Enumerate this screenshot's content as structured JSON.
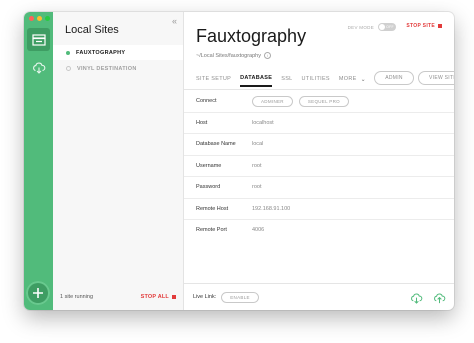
{
  "sites": {
    "title": "Local Sites",
    "collapse_icon": "«",
    "items": [
      {
        "label": "FAUXTOGRAPHY",
        "running": true
      },
      {
        "label": "VINYL DESTINATION",
        "running": false
      }
    ],
    "footer_status": "1 site running",
    "stop_all_label": "STOP ALL"
  },
  "header": {
    "title": "Fauxtography",
    "path": "~/Local Sites/fauxtography",
    "devmode_label": "DEV MODE",
    "devmode_toggle": "OFF",
    "stop_site_label": "STOP SITE"
  },
  "tabs": [
    {
      "label": "SITE SETUP",
      "active": false
    },
    {
      "label": "DATABASE",
      "active": true
    },
    {
      "label": "SSL",
      "active": false
    },
    {
      "label": "UTILITIES",
      "active": false
    },
    {
      "label": "MORE",
      "active": false
    }
  ],
  "buttons": {
    "admin": "ADMIN",
    "view_site": "VIEW SITE"
  },
  "database": {
    "connect_label": "Connect",
    "connect_buttons": [
      "ADMINER",
      "SEQUEL PRO"
    ],
    "fields": [
      {
        "label": "Host",
        "value": "localhost"
      },
      {
        "label": "Database Name",
        "value": "local"
      },
      {
        "label": "Username",
        "value": "root"
      },
      {
        "label": "Password",
        "value": "root"
      },
      {
        "label": "Remote Host",
        "value": "192.168.91.100"
      },
      {
        "label": "Remote Port",
        "value": "4006"
      }
    ]
  },
  "footer": {
    "live_link_label": "Live Link:",
    "enable_label": "ENABLE"
  },
  "colors": {
    "accent_green": "#51bb7b",
    "stop_red": "#e23b3b"
  }
}
